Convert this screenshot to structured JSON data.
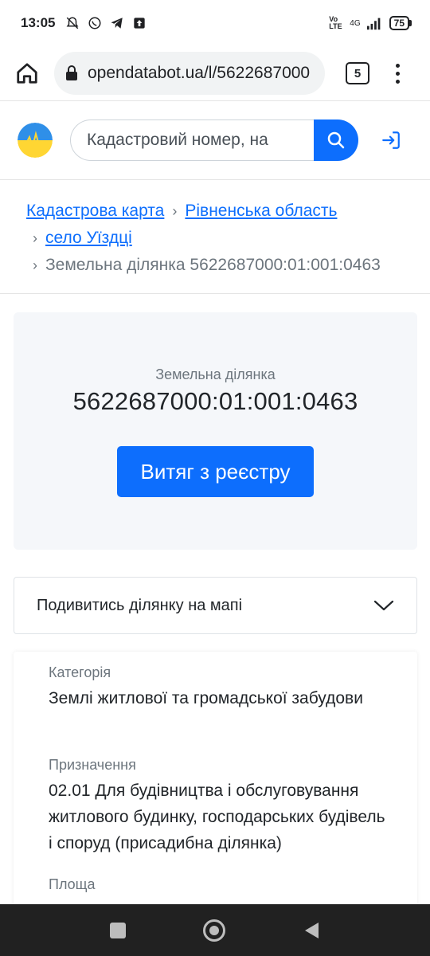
{
  "status_bar": {
    "time": "13:05",
    "battery": "75",
    "network": "4G",
    "volte": "Vo LTE"
  },
  "browser": {
    "url": "opendatabot.ua/l/5622687000",
    "tab_count": "5"
  },
  "header": {
    "search_placeholder": "Кадастровий номер, на"
  },
  "breadcrumb": {
    "items": [
      {
        "label": "Кадастрова карта"
      },
      {
        "label": "Рівненська область"
      },
      {
        "label": "село Уїздці"
      }
    ],
    "current": "Земельна ділянка 5622687000:01:001:0463",
    "separator": "›"
  },
  "plot": {
    "label": "Земельна ділянка",
    "number": "5622687000:01:001:0463",
    "extract_button": "Витяг з реєстру"
  },
  "map_toggle": {
    "label": "Подивитись ділянку на мапі"
  },
  "details": {
    "category_label": "Категорія",
    "category_value": "Землі житлової та громадської забудови",
    "purpose_label": "Призначення",
    "purpose_value": "02.01 Для будівництва і обслуговування житлового будинку, господарських будівель і споруд (присадибна ділянка)",
    "area_label": "Площа"
  },
  "colors": {
    "accent": "#0d6efd",
    "card_bg": "#f5f7fa",
    "muted": "#6c757d"
  }
}
